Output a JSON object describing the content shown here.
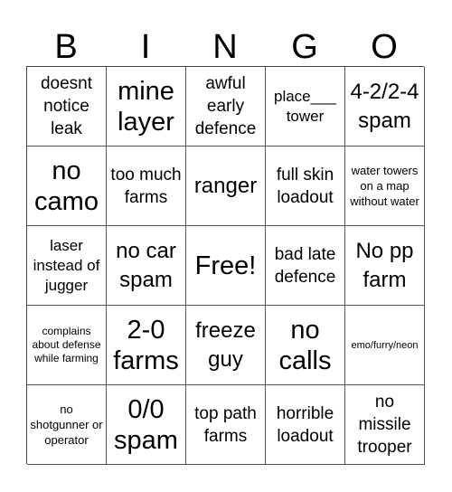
{
  "header": [
    "B",
    "I",
    "N",
    "G",
    "O"
  ],
  "cells": [
    {
      "text": "doesnt notice leak",
      "size": "s-m"
    },
    {
      "text": "mine layer",
      "size": "s-xl"
    },
    {
      "text": "awful early defence",
      "size": "s-m"
    },
    {
      "text": "place___ tower",
      "size": "s-s"
    },
    {
      "text": "4-2/2-4 spam",
      "size": "s-l"
    },
    {
      "text": "no camo",
      "size": "s-xl"
    },
    {
      "text": "too much farms",
      "size": "s-m"
    },
    {
      "text": "ranger",
      "size": "s-l"
    },
    {
      "text": "full skin loadout",
      "size": "s-m"
    },
    {
      "text": "water towers on a map without water",
      "size": "s-xs"
    },
    {
      "text": "laser instead of jugger",
      "size": "s-s"
    },
    {
      "text": "no car spam",
      "size": "s-l"
    },
    {
      "text": "Free!",
      "size": "s-xl"
    },
    {
      "text": "bad late defence",
      "size": "s-m"
    },
    {
      "text": "No pp farm",
      "size": "s-l"
    },
    {
      "text": "complains about defense while farming",
      "size": "s-xxs"
    },
    {
      "text": "2-0 farms",
      "size": "s-xl"
    },
    {
      "text": "freeze guy",
      "size": "s-l"
    },
    {
      "text": "no calls",
      "size": "s-xl"
    },
    {
      "text": "emo/furry/neon",
      "size": "s-tiny"
    },
    {
      "text": "no shotgunner or operator",
      "size": "s-xs"
    },
    {
      "text": "0/0 spam",
      "size": "s-xl"
    },
    {
      "text": "top path farms",
      "size": "s-m"
    },
    {
      "text": "horrible loadout",
      "size": "s-m"
    },
    {
      "text": "no missile trooper",
      "size": "s-m"
    }
  ]
}
